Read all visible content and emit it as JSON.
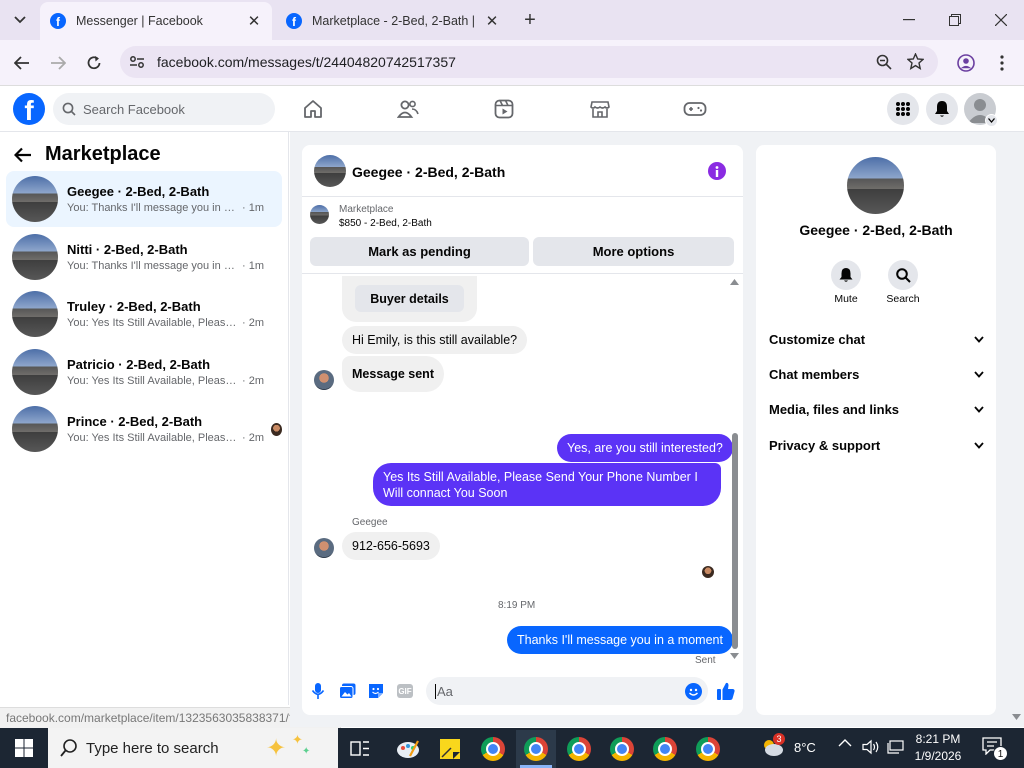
{
  "browser": {
    "tabs": [
      {
        "title": "Messenger | Facebook",
        "active": true
      },
      {
        "title": "Marketplace - 2-Bed, 2-Bath | F",
        "active": false
      }
    ],
    "url": "facebook.com/messages/t/24404820742517357",
    "status_url": "facebook.com/marketplace/item/1323563035838371/?referr..."
  },
  "fb_header": {
    "logo": "f",
    "search_placeholder": "Search Facebook",
    "nav_icons": [
      "home-icon",
      "friends-icon",
      "video-icon",
      "marketplace-icon",
      "gaming-icon"
    ]
  },
  "left_panel": {
    "title": "Marketplace",
    "conversations": [
      {
        "name": "Geegee · 2-Bed, 2-Bath",
        "preview": "You: Thanks I'll message you in a mo...",
        "time": "· 1m",
        "selected": true
      },
      {
        "name": "Nitti · 2-Bed, 2-Bath",
        "preview": "You: Thanks I'll message you in a mo...",
        "time": "· 1m",
        "selected": false
      },
      {
        "name": "Truley · 2-Bed, 2-Bath",
        "preview": "You: Yes Its Still Available, Please Sen...",
        "time": "· 2m",
        "selected": false
      },
      {
        "name": "Patricio · 2-Bed, 2-Bath",
        "preview": "You: Yes Its Still Available, Please Sen...",
        "time": "· 2m",
        "selected": false
      },
      {
        "name": "Prince · 2-Bed, 2-Bath",
        "preview": "You: Yes Its Still Available, Please S...",
        "time": "· 2m",
        "selected": false
      }
    ]
  },
  "chat": {
    "title": "Geegee · 2-Bed, 2-Bath",
    "listing_source": "Marketplace",
    "listing_detail": "$850 - 2-Bed, 2-Bath",
    "mark_pending_label": "Mark as pending",
    "more_options_label": "More options",
    "buyer_details_label": "Buyer details",
    "messages": {
      "m1": "Hi Emily, is this still available?",
      "m2": "Message sent",
      "m3": "Yes, are you still interested?",
      "m4": "Yes Its Still Available, Please Send Your Phone Number I Will connact You Soon",
      "m5_sender": "Geegee",
      "m5": "912-656-5693",
      "timestamp": "8:19 PM",
      "m6": "Thanks I'll message you in a moment",
      "status": "Sent"
    },
    "composer_placeholder": "Aa"
  },
  "right_panel": {
    "name": "Geegee · 2-Bed, 2-Bath",
    "mute_label": "Mute",
    "search_label": "Search",
    "sections": [
      "Customize chat",
      "Chat members",
      "Media, files and links",
      "Privacy & support"
    ]
  },
  "taskbar": {
    "search_placeholder": "Type here to search",
    "temperature": "8°C",
    "time": "8:21 PM",
    "date": "1/9/2026",
    "notification_count": "1",
    "weather_badge": "3"
  },
  "colors": {
    "fb_blue": "#0866ff",
    "purple_bubble": "#5b33f6",
    "selected_row": "#ebf5ff"
  }
}
